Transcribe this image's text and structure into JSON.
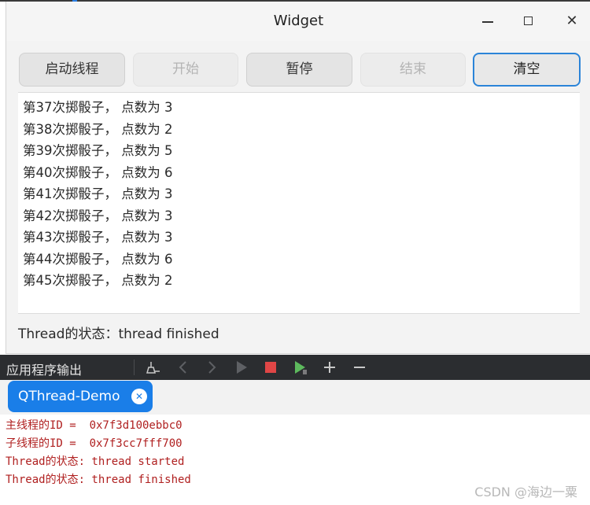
{
  "window": {
    "title": "Widget",
    "controls": {
      "minimize": "minimize",
      "maximize": "maximize",
      "close": "✕"
    }
  },
  "toolbar": {
    "start_thread": "启动线程",
    "begin": "开始",
    "pause": "暂停",
    "end": "结束",
    "clear": "清空"
  },
  "log": [
    "第37次掷骰子， 点数为 3",
    "第38次掷骰子， 点数为 2",
    "第39次掷骰子， 点数为 5",
    "第40次掷骰子， 点数为 6",
    "第41次掷骰子， 点数为 3",
    "第42次掷骰子， 点数为 3",
    "第43次掷骰子， 点数为 3",
    "第44次掷骰子， 点数为 6",
    "第45次掷骰子， 点数为 2"
  ],
  "status": "Thread的状态：thread finished",
  "output_panel": {
    "title": "应用程序输出",
    "icons": [
      "clear-output-icon",
      "prev-icon",
      "next-icon",
      "run-icon",
      "stop-icon",
      "debug-run-icon",
      "plus-icon",
      "minus-icon"
    ],
    "tab_label": "QThread-Demo",
    "lines": [
      "主线程的ID =  0x7f3d100ebbc0",
      "子线程的ID =  0x7f3cc7fff700",
      "Thread的状态: thread started",
      "Thread的状态: thread finished"
    ]
  },
  "watermark": "CSDN @海边一粟",
  "colors": {
    "accent": "#1a7ee8",
    "focus_border": "#2b84d8",
    "output_text": "#b02020",
    "panel_bg": "#2b2d30",
    "stop": "#e04646"
  }
}
